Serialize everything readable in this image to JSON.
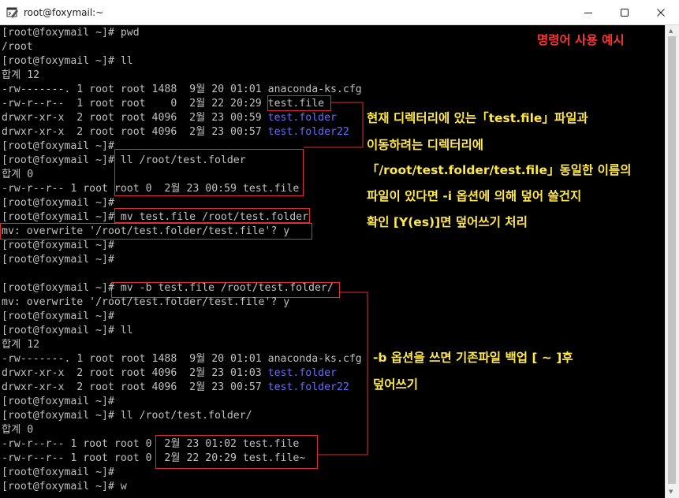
{
  "window": {
    "title": "root@foxymail:~",
    "minimize_glyph": "minimize",
    "maximize_glyph": "maximize",
    "close_glyph": "close"
  },
  "terminal": {
    "lines": [
      {
        "text": "[root@foxymail ~]# pwd"
      },
      {
        "text": "/root"
      },
      {
        "text": "[root@foxymail ~]# ll"
      },
      {
        "text": "합계 12"
      },
      {
        "text": "-rw-------. 1 root root 1488  9월 20 01:01 anaconda-ks.cfg"
      },
      {
        "pre": "-rw-r--r--  1 root root    0  2월 22 20:29 ",
        "name": "test.file",
        "color": "default"
      },
      {
        "pre": "drwxr-xr-x  2 root root 4096  2월 23 00:59 ",
        "name": "test.folder",
        "color": "blue"
      },
      {
        "pre": "drwxr-xr-x  2 root root 4096  2월 23 00:57 ",
        "name": "test.folder22",
        "color": "blue"
      },
      {
        "text": "[root@foxymail ~]#"
      },
      {
        "text": "[root@foxymail ~]# ll /root/test.folder"
      },
      {
        "text": "합계 0"
      },
      {
        "text": "-rw-r--r-- 1 root root 0  2월 23 00:59 test.file"
      },
      {
        "text": "[root@foxymail ~]#"
      },
      {
        "text": "[root@foxymail ~]# mv test.file /root/test.folder"
      },
      {
        "text": "mv: overwrite '/root/test.folder/test.file'? y"
      },
      {
        "text": "[root@foxymail ~]#"
      },
      {
        "text": "[root@foxymail ~]#"
      },
      {
        "text": ""
      },
      {
        "text": "[root@foxymail ~]# mv -b test.file /root/test.folder/"
      },
      {
        "text": "mv: overwrite '/root/test.folder/test.file'? y"
      },
      {
        "text": "[root@foxymail ~]#"
      },
      {
        "text": "[root@foxymail ~]# ll"
      },
      {
        "text": "합계 12"
      },
      {
        "text": "-rw-------. 1 root root 1488  9월 20 01:01 anaconda-ks.cfg"
      },
      {
        "pre": "drwxr-xr-x  2 root root 4096  2월 23 01:03 ",
        "name": "test.folder",
        "color": "blue"
      },
      {
        "pre": "drwxr-xr-x  2 root root 4096  2월 23 00:57 ",
        "name": "test.folder22",
        "color": "blue"
      },
      {
        "text": "[root@foxymail ~]#"
      },
      {
        "text": "[root@foxymail ~]# ll /root/test.folder/"
      },
      {
        "text": "합계 0"
      },
      {
        "text": "-rw-r--r-- 1 root root 0  2월 23 01:02 test.file"
      },
      {
        "text": "-rw-r--r-- 1 root root 0  2월 22 20:29 test.file~"
      },
      {
        "text": "[root@foxymail ~]#"
      },
      {
        "text": "[root@foxymail ~]# w"
      }
    ]
  },
  "annotations": {
    "heading": "명령어 사용 예시",
    "note1": [
      "현재 디렉터리에 있는「test.file」파일과",
      "이동하려는 디렉터리에",
      "「/root/test.folder/test.file」동일한 이름의",
      "파일이 있다면 -i 옵션에 의해 덮어 쓸건지",
      "확인 [Y(es)]면 덮어쓰기 처리"
    ],
    "note2": [
      "-b 옵션을 쓰면 기존파일 백업 [ ~ ]후",
      "덮어쓰기"
    ]
  },
  "colors": {
    "terminal_bg": "#000000",
    "terminal_text": "#c0c0c0",
    "directory": "#6a6aff",
    "highlight_box": "#e0302a",
    "heading": "#ff3434",
    "note": "#ffe84a"
  }
}
